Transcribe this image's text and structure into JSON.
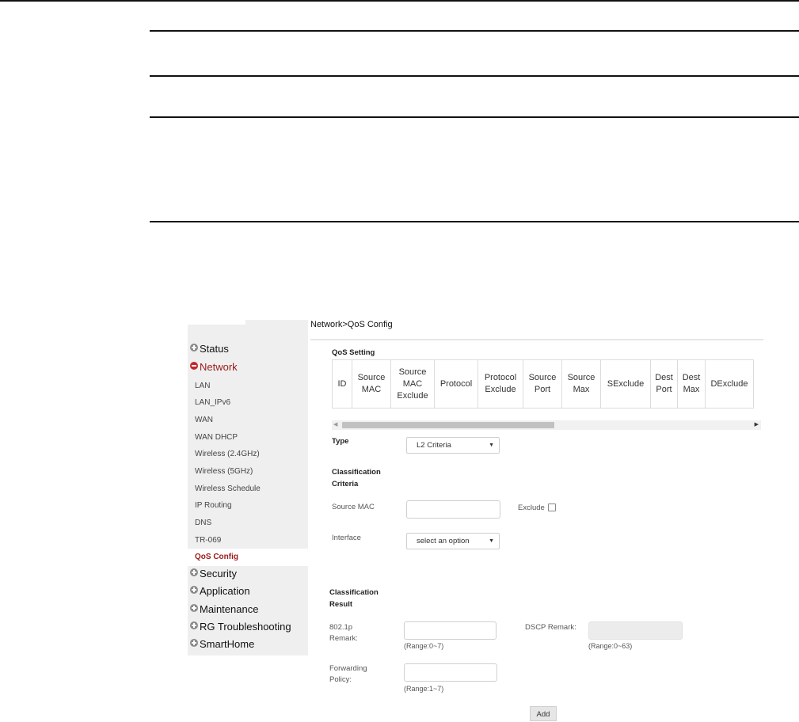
{
  "sidebar": {
    "status": "Status",
    "network": "Network",
    "network_items": [
      "LAN",
      "LAN_IPv6",
      "WAN",
      "WAN DHCP",
      "Wireless (2.4GHz)",
      "Wireless (5GHz)",
      "Wireless Schedule",
      "IP Routing",
      "DNS",
      "TR-069",
      "QoS Config"
    ],
    "security": "Security",
    "application": "Application",
    "maintenance": "Maintenance",
    "rg_troubleshooting": "RG Troubleshooting",
    "smarthome": "SmartHome"
  },
  "breadcrumb": "Network>QoS Config",
  "qos_setting": {
    "title": "QoS Setting",
    "columns": [
      "ID",
      "Source\nMAC",
      "Source\nMAC\nExclude",
      "Protocol",
      "Protocol\nExclude",
      "Source\nPort",
      "Source\nMax",
      "SExclude",
      "Dest\nPort",
      "Dest\nMax",
      "DExclude"
    ]
  },
  "form": {
    "type_label": "Type",
    "type_value": "L2 Criteria",
    "classification_criteria": "Classification\nCriteria",
    "source_mac_label": "Source MAC",
    "exclude_label": "Exclude",
    "interface_label": "Interface",
    "interface_value": "select an option",
    "classification_result": "Classification\nResult",
    "remark_8021p_label": "802.1p\nRemark:",
    "remark_8021p_range": "(Range:0~7)",
    "dscp_remark_label": "DSCP Remark:",
    "dscp_remark_range": "(Range:0~63)",
    "forwarding_policy_label": "Forwarding\nPolicy:",
    "forwarding_policy_range": "(Range:1~7)",
    "add_button": "Add"
  }
}
